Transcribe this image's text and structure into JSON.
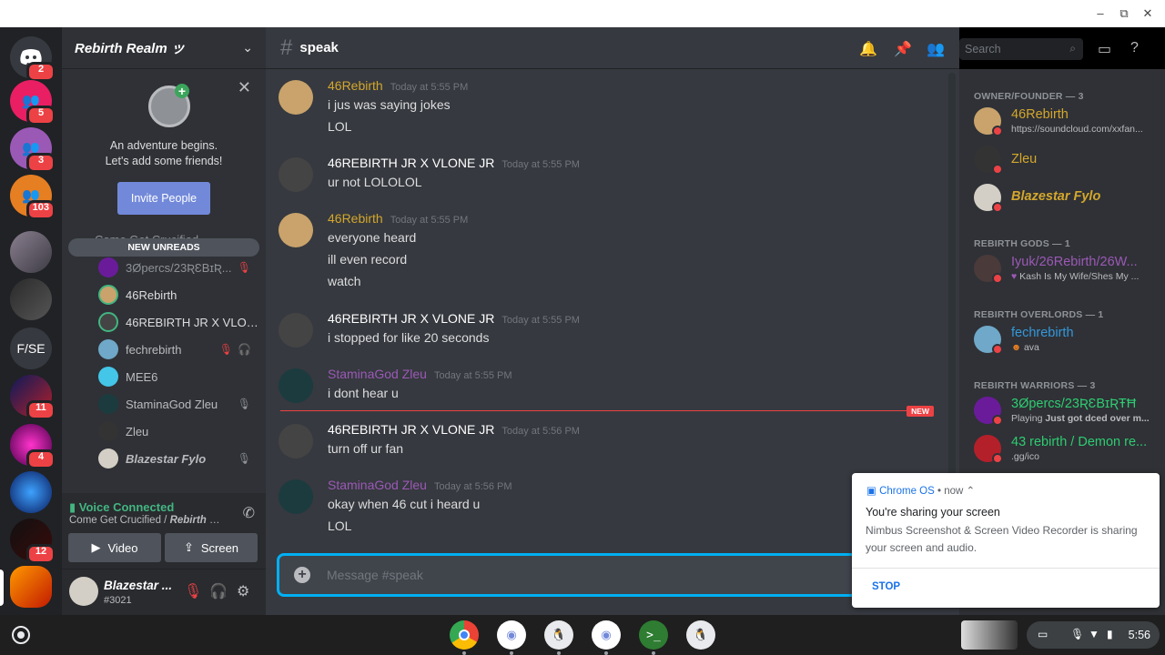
{
  "window": {
    "controls": [
      "–",
      "⧉",
      "✕"
    ]
  },
  "rail": {
    "badges": [
      "2",
      "5",
      "3",
      "103",
      "11",
      "4",
      "12"
    ],
    "text_server": "F/SE"
  },
  "sidebar": {
    "server_name": "Rebirth Realm ッ",
    "invite_card": {
      "line1": "An adventure begins.",
      "line2": "Let's add some friends!",
      "button": "Invite People"
    },
    "voice_channel": "Come Get Crucified",
    "new_unreads": "NEW UNREADS",
    "voice_users": [
      {
        "name": "3Øpercs/23ƦƐBɪƦ..."
      },
      {
        "name": "46Rebirth"
      },
      {
        "name": "46REBIRTH JR X VLONE ..."
      },
      {
        "name": "fechrebirth"
      },
      {
        "name": "MEE6"
      },
      {
        "name": "StaminaGod Zleu"
      },
      {
        "name": "Zleu"
      },
      {
        "name": "Blazestar Fylo"
      }
    ],
    "voice_panel": {
      "title": "Voice Connected",
      "channel": "Come Get Crucified",
      "sep": " / ",
      "server": "Rebirth Re...",
      "video_label": "Video",
      "screen_label": "Screen"
    },
    "user_panel": {
      "name": "Blazestar ...",
      "tag": "#3021"
    }
  },
  "chat": {
    "channel": "speak",
    "search_placeholder": "Search",
    "messages": [
      {
        "author": "46Rebirth",
        "time": "Today at 5:55 PM",
        "lines": [
          "i jus was saying jokes",
          "LOL"
        ]
      },
      {
        "author": "46REBIRTH JR X VLONE JR",
        "time": "Today at 5:55 PM",
        "lines": [
          "ur not LOLOLOL"
        ]
      },
      {
        "author": "46Rebirth",
        "time": "Today at 5:55 PM",
        "lines": [
          "everyone heard",
          "ill even record",
          "watch"
        ]
      },
      {
        "author": "46REBIRTH JR X VLONE JR",
        "time": "Today at 5:55 PM",
        "lines": [
          "i stopped for like 20 seconds"
        ]
      },
      {
        "author": "StaminaGod Zleu",
        "time": "Today at 5:55 PM",
        "lines": [
          "i dont hear u"
        ]
      },
      {
        "author": "46REBIRTH JR X VLONE JR",
        "time": "Today at 5:56 PM",
        "lines": [
          "turn off ur fan"
        ]
      },
      {
        "author": "StaminaGod Zleu",
        "time": "Today at 5:56 PM",
        "lines": [
          "okay when 46 cut i heard u",
          "LOL"
        ]
      }
    ],
    "new_tag": "NEW",
    "composer_placeholder": "Message #speak"
  },
  "members": {
    "groups": [
      {
        "role": "OWNER/FOUNDER — 3",
        "items": [
          {
            "name": "46Rebirth",
            "status": "https://soundcloud.com/xxfan..."
          },
          {
            "name": "Zleu",
            "status": ""
          },
          {
            "name": "Blazestar Fylo",
            "status": ""
          }
        ]
      },
      {
        "role": "REBIRTH GODS — 1",
        "items": [
          {
            "name": "Iyuk/26Rebirth/26W...",
            "status": "Kash Is My Wife/Shes My ..."
          }
        ]
      },
      {
        "role": "REBIRTH OVERLORDS — 1",
        "items": [
          {
            "name": "fechrebirth",
            "status": "ava"
          }
        ]
      },
      {
        "role": "REBIRTH WARRIORS — 3",
        "items": [
          {
            "name": "3Øpercs/23ƦƐBɪƦŦĦ",
            "status_prefix": "Playing ",
            "status": "Just got dced over m..."
          },
          {
            "name": "43 rebirth / Demon re...",
            "status": ".gg/ico"
          }
        ]
      }
    ]
  },
  "notification": {
    "app": "Chrome OS",
    "when": " • now ⌃",
    "title": "You're sharing your screen",
    "body": "Nimbus Screenshot & Screen Video Recorder is sharing your screen and audio.",
    "action": "STOP"
  },
  "shelf": {
    "time": "5:56"
  },
  "colors": {
    "gold": "#d4a72c",
    "purple": "#9b59b6",
    "white": "#ffffff",
    "blue_role": "#3498db",
    "green_role": "#2ecc71",
    "accent": "#7289da"
  }
}
